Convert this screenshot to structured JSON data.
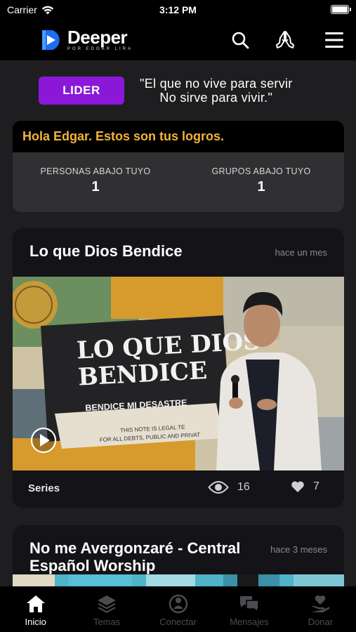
{
  "status_bar": {
    "carrier": "Carrier",
    "time": "3:12 PM"
  },
  "header": {
    "logo_word": "Deeper",
    "logo_sub": "POR EDGAR LIRA",
    "icons": [
      "search-icon",
      "praying-hands-icon",
      "menu-icon"
    ]
  },
  "leader": {
    "badge": "LIDER",
    "quote_line1": "\"El que no vive para servir",
    "quote_line2": "No sirve para vivir.\""
  },
  "achievements": {
    "title": "Hola Edgar. Estos son tus logros.",
    "stats": [
      {
        "label": "PERSONAS ABAJO TUYO",
        "value": "1"
      },
      {
        "label": "GRUPOS ABAJO TUYO",
        "value": "1"
      }
    ]
  },
  "posts": [
    {
      "title": "Lo que Dios Bendice",
      "time": "hace un mes",
      "image_title_1": "LO QUE DIOS",
      "image_title_2": "BENDICE",
      "image_subtitle": "BENDICE MI DESASTRE",
      "image_note_1": "THIS NOTE IS LEGAL TE",
      "image_note_2": "FOR ALL DEBTS, PUBLIC AND PRIVAT",
      "category": "Series",
      "views": "16",
      "likes": "7"
    },
    {
      "title": "No me Avergonzaré - Central Español Worship",
      "time": "hace 3 meses"
    }
  ],
  "tabs": [
    {
      "label": "Inicio",
      "icon": "home-icon",
      "active": true
    },
    {
      "label": "Temas",
      "icon": "layers-icon",
      "active": false
    },
    {
      "label": "Conectar",
      "icon": "connect-icon",
      "active": false
    },
    {
      "label": "Mensajes",
      "icon": "messages-icon",
      "active": false
    },
    {
      "label": "Donar",
      "icon": "donate-icon",
      "active": false
    }
  ],
  "colors": {
    "accent_purple": "#8b18d9",
    "gold": "#f0b33a",
    "logo_blue": "#1e6cf0"
  }
}
